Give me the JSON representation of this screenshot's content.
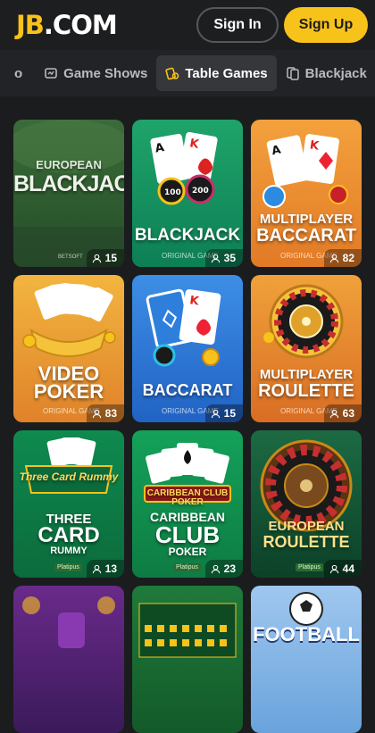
{
  "header": {
    "logo_jb": "JB",
    "logo_com": ".COM",
    "signin_label": "Sign In",
    "signup_label": "Sign Up"
  },
  "tabs": {
    "edge_left": "o",
    "items": [
      {
        "label": "Game Shows",
        "icon": "game-shows-icon",
        "active": false
      },
      {
        "label": "Table Games",
        "icon": "table-games-icon",
        "active": true
      },
      {
        "label": "Blackjack",
        "icon": "blackjack-icon",
        "active": false
      }
    ]
  },
  "colors": {
    "accent": "#f7c21a",
    "background": "#1b1c1e"
  },
  "games": [
    {
      "title": "EUROPEAN BLACKJACK",
      "title_line1": "EUROPEAN",
      "title_line2": "BLACKJACK",
      "provider": "BETSOFT",
      "players": "15"
    },
    {
      "title": "BLACKJACK",
      "provider": "ORIGINAL GAME",
      "players": "35"
    },
    {
      "title_line1": "MULTIPLAYER",
      "title_line2": "BACCARAT",
      "provider": "ORIGINAL GAME",
      "players": "82"
    },
    {
      "title_line1": "VIDEO",
      "title_line2": "POKER",
      "provider": "ORIGINAL GAME",
      "players": "83"
    },
    {
      "title": "BACCARAT",
      "provider": "ORIGINAL GAME",
      "players": "15"
    },
    {
      "title_line1": "MULTIPLAYER",
      "title_line2": "ROULETTE",
      "provider": "ORIGINAL GAME",
      "players": "63"
    },
    {
      "logo": "Three Card Rummy",
      "title_line1": "THREE",
      "title_line2": "CARD",
      "title_line3": "RUMMY",
      "provider": "Platipus",
      "players": "13"
    },
    {
      "logo": "CARIBBEAN CLUB POKER",
      "title_line1": "CARIBBEAN",
      "title_line2": "CLUB",
      "title_line3": "POKER",
      "provider": "Platipus",
      "players": "23"
    },
    {
      "title_line1": "EUROPEAN",
      "title_line2": "ROULETTE",
      "provider": "Platipus",
      "players": "44"
    },
    {
      "title": ""
    },
    {
      "title": ""
    },
    {
      "title": "FOOTBALL"
    }
  ]
}
